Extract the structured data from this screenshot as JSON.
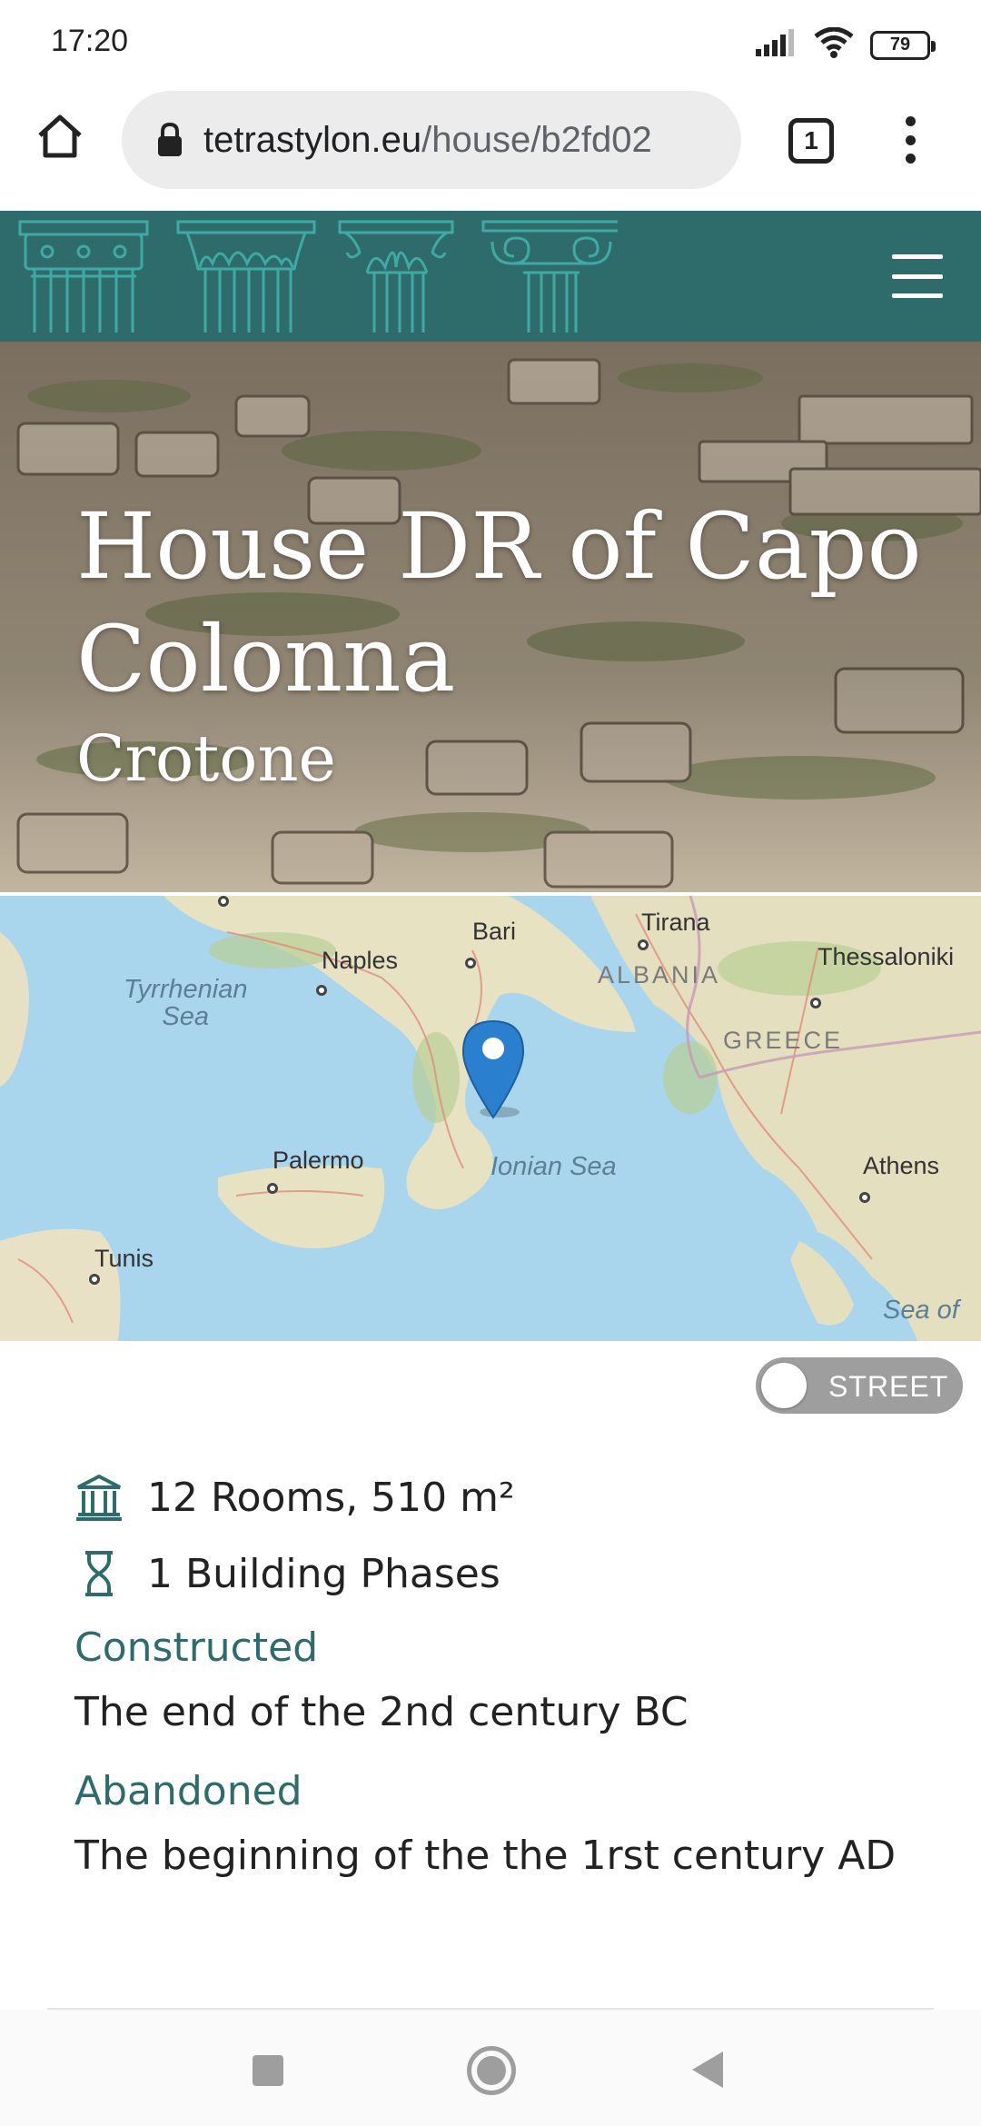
{
  "status_bar": {
    "time": "17:20",
    "battery_level": "79",
    "icons": [
      "signal-icon",
      "wifi-icon",
      "battery-icon"
    ]
  },
  "browser": {
    "url_domain": "tetrastylon.eu",
    "url_path": "/house/b2fd02",
    "tab_count": "1",
    "icons": [
      "home-icon",
      "lock-icon",
      "tab-switcher-icon",
      "overflow-menu-icon"
    ]
  },
  "site_header": {
    "background_color": "#2e6b6b",
    "logo_icons": [
      "tuscan-capital-icon",
      "corinthian-capital-icon",
      "composite-capital-icon",
      "ionic-capital-icon"
    ],
    "menu_icon": "hamburger-menu-icon"
  },
  "hero": {
    "title": "House DR of Capo Colonna",
    "subtitle": "Crotone"
  },
  "map": {
    "marker_icon": "location-pin-icon",
    "labels": {
      "bari": "Bari",
      "tirana": "Tirana",
      "naples": "Naples",
      "thessaloniki": "Thessaloniki",
      "albania": "ALBANIA",
      "tyrrhenian": "Tyrrhenian\nSea",
      "greece": "GREECE",
      "palermo": "Palermo",
      "ionian": "Ionian Sea",
      "athens": "Athens",
      "tunis": "Tunis",
      "sea_of": "Sea of"
    }
  },
  "toggle": {
    "label": "STREET",
    "state": "off"
  },
  "details": {
    "rooms_icon": "museum-building-icon",
    "rooms_text": "12 Rooms, 510 m²",
    "phases_icon": "hourglass-icon",
    "phases_text": "1 Building Phases",
    "constructed_label": "Constructed",
    "constructed_value": "The end of the 2nd century BC",
    "abandoned_label": "Abandoned",
    "abandoned_value": "The beginning of the the 1rst century AD",
    "accent_color": "#2e6b6b"
  },
  "nav_bar": {
    "icons": [
      "recent-apps-icon",
      "home-nav-icon",
      "back-icon"
    ]
  }
}
